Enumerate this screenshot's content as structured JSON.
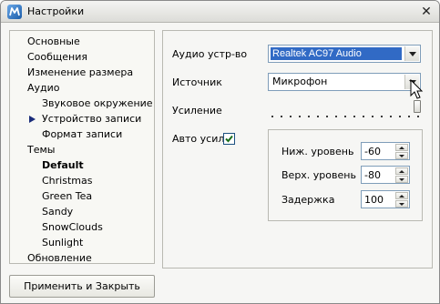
{
  "window": {
    "title": "Настройки"
  },
  "icons": {
    "app": "app-logo-icon",
    "close": "close-icon",
    "current_section": "arrow-right-icon"
  },
  "colors": {
    "accent": "#316ac5",
    "nav_arrow": "#1a2c7a",
    "check": "#1a6e1a"
  },
  "sidebar": {
    "items": [
      {
        "label": "Основные"
      },
      {
        "label": "Сообщения"
      },
      {
        "label": "Изменение размера"
      },
      {
        "label": "Аудио"
      },
      {
        "label": "Звуковое окружение"
      },
      {
        "label": "Устройство записи"
      },
      {
        "label": "Формат записи"
      },
      {
        "label": "Темы"
      },
      {
        "label": "Default"
      },
      {
        "label": "Christmas"
      },
      {
        "label": "Green Tea"
      },
      {
        "label": "Sandy"
      },
      {
        "label": "SnowClouds"
      },
      {
        "label": "Sunlight"
      },
      {
        "label": "Обновление"
      }
    ],
    "current": "Устройство записи",
    "selected_theme": "Default"
  },
  "apply_button": {
    "label": "Применить и Закрыть"
  },
  "form": {
    "audio_device": {
      "label": "Аудио устр-во",
      "value": "Realtek AC97 Audio"
    },
    "source": {
      "label": "Источник",
      "value": "Микрофон"
    },
    "gain": {
      "label": "Усиление",
      "level": 1.0
    },
    "auto_gain": {
      "label": "Авто усил",
      "checked": true
    },
    "low_level": {
      "label": "Ниж. уровень",
      "value": "-60"
    },
    "high_level": {
      "label": "Верх. уровень",
      "value": "-80"
    },
    "delay": {
      "label": "Задержка",
      "value": "100"
    }
  }
}
